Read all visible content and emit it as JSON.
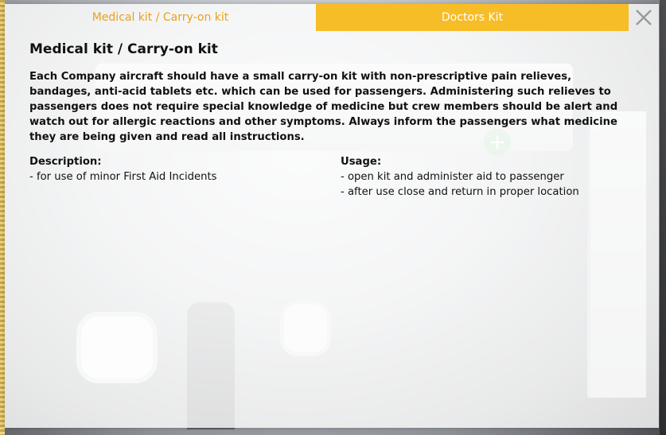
{
  "tabs": [
    {
      "label": "Medical kit / Carry-on kit",
      "active": false
    },
    {
      "label": "Doctors Kit",
      "active": true
    }
  ],
  "close_icon": "close-icon",
  "content": {
    "title": "Medical kit / Carry-on kit",
    "paragraph": "Each Company aircraft should have a small carry-on kit with non-prescriptive pain relieves, bandages, anti-acid tablets etc. which can be used for passengers. Administering such relieves to passengers does not require special knowledge of medicine but crew members should be alert and watch out for allergic reactions and other symptoms. Always inform the passengers what medicine they are being given and read all instructions.",
    "description": {
      "label": "Description:",
      "items": [
        "- for use of minor First Aid Incidents"
      ]
    },
    "usage": {
      "label": "Usage:",
      "items": [
        "- open kit and administer aid to passenger",
        "- after use close and return in proper location"
      ]
    }
  },
  "colors": {
    "accent": "#f7bd26",
    "inactive_tab_text": "#e8a21c"
  }
}
